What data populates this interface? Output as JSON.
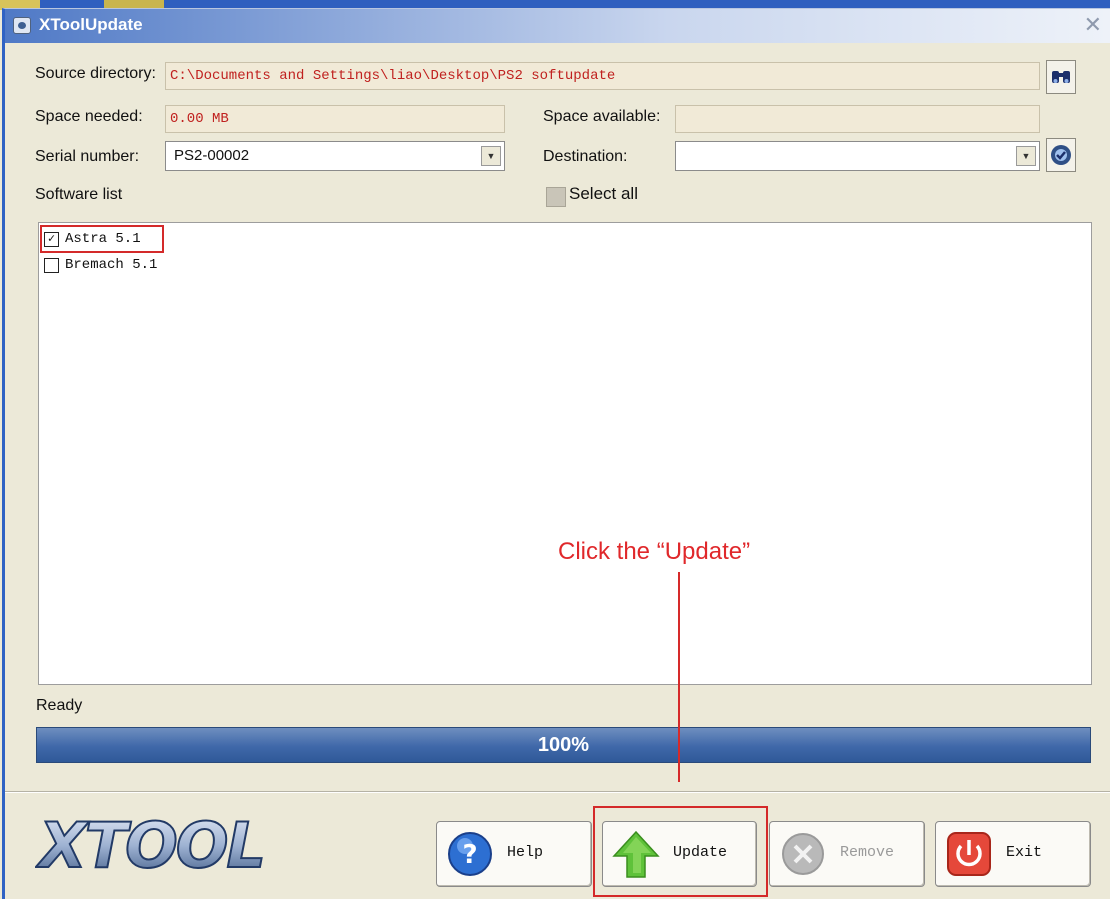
{
  "window": {
    "title": "XToolUpdate"
  },
  "form": {
    "source_label": "Source directory:",
    "source_value": "C:\\Documents and Settings\\liao\\Desktop\\PS2 softupdate",
    "space_needed_label": "Space needed:",
    "space_needed_value": "0.00 MB",
    "space_available_label": "Space available:",
    "space_available_value": "",
    "serial_label": "Serial number:",
    "serial_value": "PS2-00002",
    "destination_label": "Destination:",
    "destination_value": "",
    "software_list_label": "Software list",
    "select_all_label": "Select all"
  },
  "software_list": [
    {
      "name": "Astra 5.1",
      "checked": true
    },
    {
      "name": "Bremach 5.1",
      "checked": false
    }
  ],
  "status": {
    "text": "Ready",
    "progress_label": "100%",
    "progress_fraction": 1.0
  },
  "buttons": {
    "help": "Help",
    "update": "Update",
    "remove": "Remove",
    "exit": "Exit"
  },
  "annotation": {
    "text": "Click the “Update”"
  },
  "logo": {
    "text": "XTOOL"
  },
  "colors": {
    "accent_red": "#e0282b",
    "progress_blue": "#3f68a9",
    "update_green": "#5fc23a"
  }
}
